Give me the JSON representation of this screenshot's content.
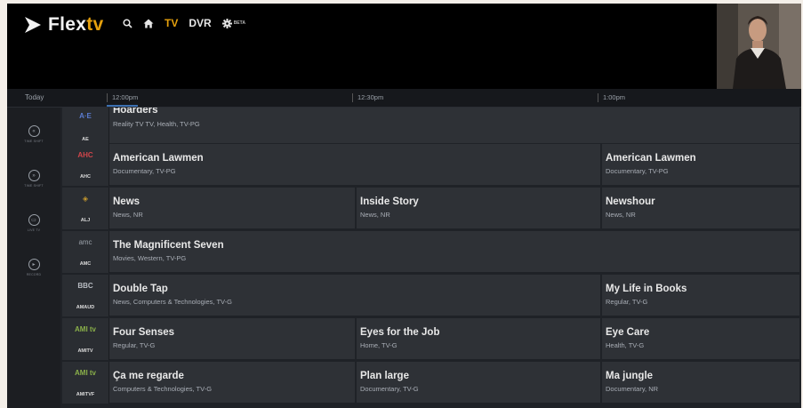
{
  "header": {
    "brand_main": "Flex",
    "brand_accent": "tv",
    "nav": {
      "tv_label": "TV",
      "dvr_label": "DVR",
      "beta_label": "BETA"
    }
  },
  "timebar": {
    "today_label": "Today",
    "ticks": [
      "12:00pm",
      "12:30pm",
      "1:00pm"
    ]
  },
  "sidenav": {
    "items": [
      {
        "label": "TIME SHIFT"
      },
      {
        "label": "TIME SHIFT"
      },
      {
        "label": "LIVE TV"
      },
      {
        "label": "RECORD"
      }
    ]
  },
  "channels": [
    {
      "logo": "A·E",
      "name": "AE",
      "logo_color": "#5a7bd0",
      "programs": [
        {
          "title": "Hoarders",
          "meta": "Reality TV TV, Health, TV-PG"
        }
      ]
    },
    {
      "logo": "AHC",
      "name": "AHC",
      "logo_color": "#d0454a",
      "programs": [
        {
          "title": "American Lawmen",
          "meta": "Documentary, TV-PG"
        },
        {
          "title": "American Lawmen",
          "meta": "Documentary, TV-PG"
        }
      ]
    },
    {
      "logo": "◈",
      "name": "ALJ",
      "logo_color": "#c79a2e",
      "programs": [
        {
          "title": "News",
          "meta": "News, NR"
        },
        {
          "title": "Inside Story",
          "meta": "News, NR"
        },
        {
          "title": "Newshour",
          "meta": "News, NR"
        }
      ]
    },
    {
      "logo": "amc",
      "name": "AMC",
      "logo_color": "#9aa0a8",
      "programs": [
        {
          "title": "The Magnificent Seven",
          "meta": "Movies, Western, TV-PG"
        }
      ]
    },
    {
      "logo": "BBC",
      "name": "AMAUD",
      "logo_color": "#b8bcc2",
      "programs": [
        {
          "title": "Double Tap",
          "meta": "News, Computers & Technologies, TV-G"
        },
        {
          "title": "My Life in Books",
          "meta": "Regular, TV-G"
        }
      ]
    },
    {
      "logo": "AMI tv",
      "name": "AMITV",
      "logo_color": "#8ab04a",
      "programs": [
        {
          "title": "Four Senses",
          "meta": "Regular, TV-G"
        },
        {
          "title": "Eyes for the Job",
          "meta": "Home, TV-G"
        },
        {
          "title": "Eye Care",
          "meta": "Health, TV-G"
        }
      ]
    },
    {
      "logo": "AMI tv",
      "name": "AMITVF",
      "logo_color": "#8ab04a",
      "programs": [
        {
          "title": "Ça me regarde",
          "meta": "Computers & Technologies, TV-G"
        },
        {
          "title": "Plan large",
          "meta": "Documentary, TV-G"
        },
        {
          "title": "Ma jungle",
          "meta": "Documentary, NR"
        }
      ]
    }
  ],
  "colors": {
    "accent": "#e5a00d",
    "background": "#1f2227",
    "cell": "#2e3136",
    "now_marker": "#3b6fb0"
  }
}
